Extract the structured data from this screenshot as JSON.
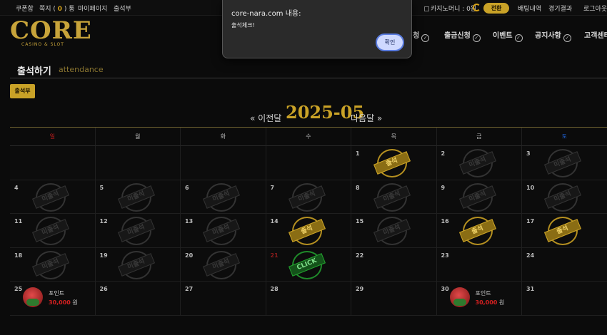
{
  "topbar": {
    "links": [
      "쿠폰함",
      "쪽지",
      "마이페이지",
      "출석부"
    ],
    "message_count": "0",
    "message_unit": "통",
    "casino_money_label": "카지노머니 : 0원",
    "charge_button": "전환",
    "bet_history": "배팅내역",
    "game_results": "경기결과",
    "logout": "로그아웃"
  },
  "logo": {
    "text": "CORE",
    "subtitle": "CASINO & SLOT"
  },
  "nav": {
    "items": [
      "충전신청",
      "출금신청",
      "이벤트",
      "공지사항",
      "고객센터"
    ]
  },
  "page": {
    "title": "출석하기",
    "title_en": "attendance",
    "attendance_button": "출석부"
  },
  "calendar": {
    "prev_label": "« 이전달",
    "month": "2025-05",
    "next_label": "다음달 »",
    "weekdays": [
      "일",
      "월",
      "화",
      "수",
      "목",
      "금",
      "토"
    ],
    "stamp_attended": "출석",
    "stamp_missed": "미출석",
    "stamp_click": "CLICK",
    "point_label": "포인트",
    "point_amount": "30,000",
    "point_unit": "원"
  },
  "colors": {
    "accent": "#c9a227",
    "sunday": "#c81e1e",
    "saturday": "#1e5fd0",
    "background": "#0b0b0b"
  },
  "dialog": {
    "title": "core-nara.com 내용:",
    "message": "출석체크!",
    "ok_button": "확인"
  }
}
